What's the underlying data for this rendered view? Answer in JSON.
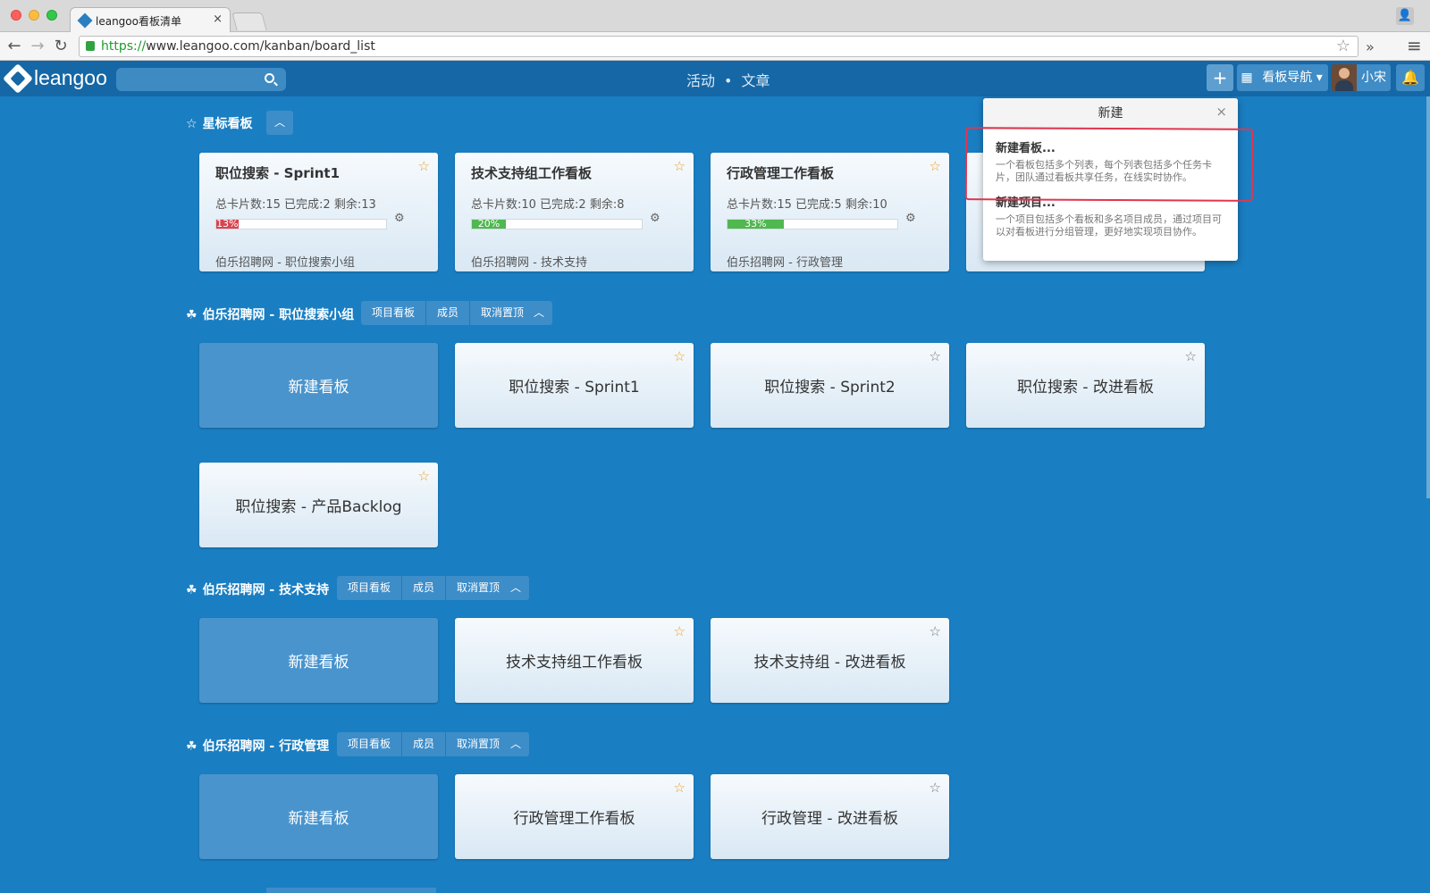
{
  "browser": {
    "tab_title": "leangoo看板清单",
    "tab_close": "×",
    "url_scheme": "https://",
    "url_rest": "www.leangoo.com/kanban/board_list",
    "back": "←",
    "forward": "→",
    "reload": "↻",
    "bookmark_star": "☆",
    "more_ext": "»",
    "menu": "≡",
    "profile": "👤"
  },
  "header": {
    "logo": "leangoo",
    "search_placeholder": "",
    "nav_activity": "活动",
    "nav_dot": "•",
    "nav_article": "文章",
    "plus": "+",
    "grid": "▦",
    "board_nav": "看板导航 ▾",
    "user": "小宋",
    "bell": "🔔"
  },
  "starred": {
    "title": "星标看板",
    "icon": "☆",
    "collapse": "︿",
    "cards": [
      {
        "title": "职位搜索 - Sprint1",
        "counts": "总卡片数:15 已完成:2 剩余:13",
        "progress": 13,
        "progress_label": "13%",
        "progress_color": "#d9444f",
        "project": "伯乐招聘网 - 职位搜索小组",
        "star": "☆"
      },
      {
        "title": "技术支持组工作看板",
        "counts": "总卡片数:10 已完成:2 剩余:8",
        "progress": 20,
        "progress_label": "20%",
        "progress_color": "#4fb84f",
        "project": "伯乐招聘网 - 技术支持",
        "star": "☆"
      },
      {
        "title": "行政管理工作看板",
        "counts": "总卡片数:15 已完成:5 剩余:10",
        "progress": 33,
        "progress_label": "33%",
        "progress_color": "#4fb84f",
        "project": "伯乐招聘网 - 行政管理",
        "star": "☆"
      }
    ]
  },
  "popup": {
    "title": "新建",
    "close": "×",
    "new_board": "新建看板...",
    "new_board_desc": "一个看板包括多个列表，每个列表包括多个任务卡片，团队通过看板共享任务，在线实时协作。",
    "new_project": "新建项目...",
    "new_project_desc": "一个项目包括多个看板和多名项目成员，通过项目可以对看板进行分组管理，更好地实现项目协作。"
  },
  "group_buttons": {
    "project_board": "项目看板",
    "members": "成员",
    "unpin": "取消置顶",
    "collapse": "︿"
  },
  "group_icon": "☘",
  "groups": [
    {
      "title": "伯乐招聘网 - 职位搜索小组",
      "new_board": "新建看板",
      "boards": [
        {
          "name": "职位搜索 - Sprint1",
          "star": "☆",
          "starred": true
        },
        {
          "name": "职位搜索 - Sprint2",
          "star": "☆",
          "starred": false
        },
        {
          "name": "职位搜索 - 改进看板",
          "star": "☆",
          "starred": false
        },
        {
          "name": "职位搜索 - 产品Backlog",
          "star": "☆",
          "starred": true
        }
      ]
    },
    {
      "title": "伯乐招聘网 - 技术支持",
      "new_board": "新建看板",
      "boards": [
        {
          "name": "技术支持组工作看板",
          "star": "☆",
          "starred": true
        },
        {
          "name": "技术支持组 - 改进看板",
          "star": "☆",
          "starred": false
        }
      ]
    },
    {
      "title": "伯乐招聘网 - 行政管理",
      "new_board": "新建看板",
      "boards": [
        {
          "name": "行政管理工作看板",
          "star": "☆",
          "starred": true
        },
        {
          "name": "行政管理 - 改进看板",
          "star": "☆",
          "starred": false
        }
      ]
    }
  ],
  "gear": "⚙"
}
